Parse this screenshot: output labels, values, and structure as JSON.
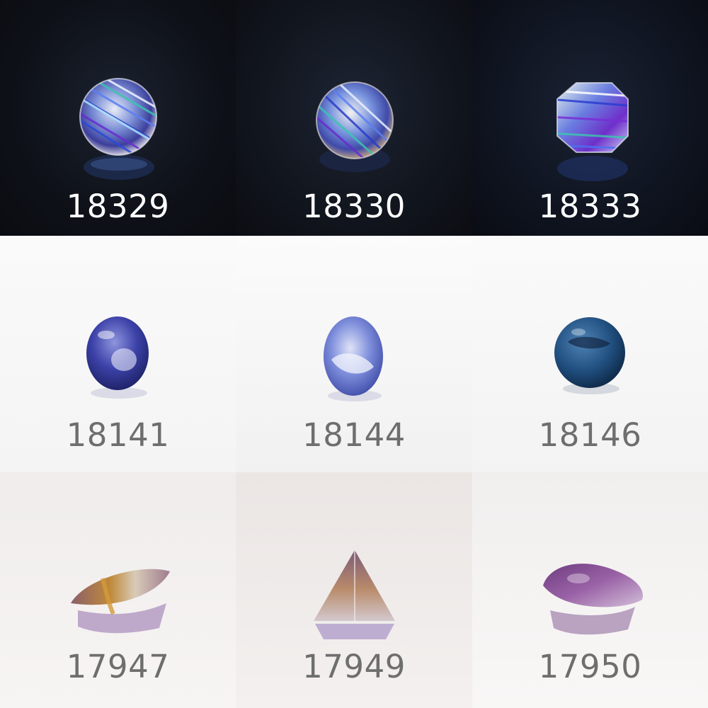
{
  "tiles": [
    {
      "code": "18329",
      "shape": "round",
      "material": "rutilated quartz faceted"
    },
    {
      "code": "18330",
      "shape": "round",
      "material": "rutilated quartz faceted"
    },
    {
      "code": "18333",
      "shape": "octagon",
      "material": "rutilated quartz faceted"
    },
    {
      "code": "18141",
      "shape": "oval cabochon",
      "material": "blue cabochon"
    },
    {
      "code": "18144",
      "shape": "oval cabochon",
      "material": "blue cabochon"
    },
    {
      "code": "18146",
      "shape": "round cabochon",
      "material": "blue cabochon"
    },
    {
      "code": "17947",
      "shape": "marquise",
      "material": "amethyst quartz"
    },
    {
      "code": "17949",
      "shape": "trillion",
      "material": "amethyst quartz"
    },
    {
      "code": "17950",
      "shape": "pear",
      "material": "amethyst quartz"
    }
  ],
  "colors": {
    "dark_label": "#ffffff",
    "light_label": "#6e6e6e"
  }
}
